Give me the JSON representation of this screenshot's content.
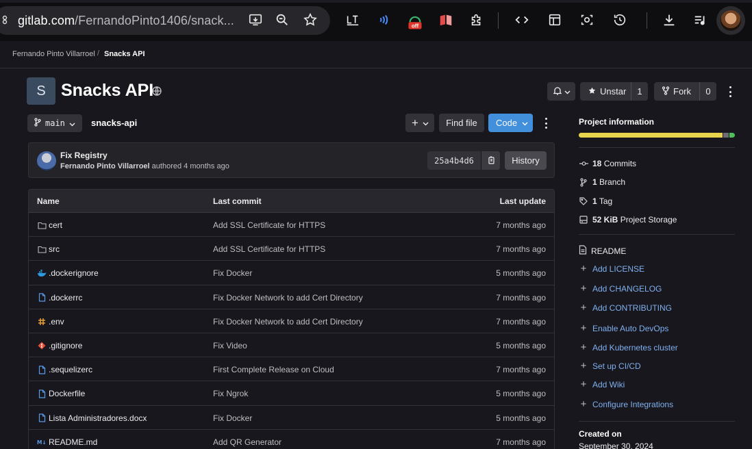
{
  "browser": {
    "url_host": "gitlab.com",
    "url_path": "/FernandoPinto1406/snack...",
    "extension_badge": "off"
  },
  "breadcrumb": {
    "owner": "Fernando Pinto Villarroel",
    "separator": "/",
    "project": "Snacks API"
  },
  "project": {
    "avatar_letter": "S",
    "title": "Snacks API",
    "unstar_label": "Unstar",
    "star_count": "1",
    "fork_label": "Fork",
    "fork_count": "0"
  },
  "branch": {
    "name": "main",
    "path": "snacks-api"
  },
  "actions": {
    "add_label": "+",
    "find_file_label": "Find file",
    "code_label": "Code"
  },
  "last_commit": {
    "title": "Fix Registry",
    "author": "Fernando Pinto Villarroel",
    "meta": "authored 4 months ago",
    "sha": "25a4b4d6",
    "history_label": "History"
  },
  "table": {
    "headers": [
      "Name",
      "Last commit",
      "Last update"
    ],
    "rows": [
      {
        "name": "cert",
        "icon": "folder-icon",
        "commit": "Add SSL Certificate for HTTPS",
        "updated": "7 months ago"
      },
      {
        "name": "src",
        "icon": "folder-icon",
        "commit": "Add SSL Certificate for HTTPS",
        "updated": "7 months ago"
      },
      {
        "name": ".dockerignore",
        "icon": "docker-icon",
        "commit": "Fix Docker",
        "updated": "5 months ago"
      },
      {
        "name": ".dockerrc",
        "icon": "file-icon",
        "commit": "Fix Docker Network to add Cert Directory",
        "updated": "7 months ago"
      },
      {
        "name": ".env",
        "icon": "env-icon",
        "commit": "Fix Docker Network to add Cert Directory",
        "updated": "7 months ago"
      },
      {
        "name": ".gitignore",
        "icon": "git-icon",
        "commit": "Fix Video",
        "updated": "5 months ago"
      },
      {
        "name": ".sequelizerc",
        "icon": "file-icon",
        "commit": "First Complete Release on Cloud",
        "updated": "7 months ago"
      },
      {
        "name": "Dockerfile",
        "icon": "file-icon",
        "commit": "Fix Ngrok",
        "updated": "5 months ago"
      },
      {
        "name": "Lista Administradores.docx",
        "icon": "file-icon",
        "commit": "Fix Docker",
        "updated": "5 months ago"
      },
      {
        "name": "README.md",
        "icon": "markdown-icon",
        "commit": "Add QR Generator",
        "updated": "7 months ago"
      }
    ]
  },
  "sidebar": {
    "title": "Project information",
    "languages": [
      {
        "color": "#e8d44d",
        "fraction": 0.93
      },
      {
        "color": "#6c6c72",
        "fraction": 0.035
      },
      {
        "color": "#4fbf5a",
        "fraction": 0.035
      }
    ],
    "stats": [
      {
        "count": "18",
        "label": "Commits",
        "icon": "commit-icon"
      },
      {
        "count": "1",
        "label": "Branch",
        "icon": "branch-icon"
      },
      {
        "count": "1",
        "label": "Tag",
        "icon": "tag-icon"
      },
      {
        "count": "52 KiB",
        "label": "Project Storage",
        "icon": "storage-icon"
      }
    ],
    "readme_label": "README",
    "links": [
      "Add LICENSE",
      "Add CHANGELOG",
      "Add CONTRIBUTING",
      "Enable Auto DevOps",
      "Add Kubernetes cluster",
      "Set up CI/CD",
      "Add Wiki",
      "Configure Integrations"
    ],
    "created_label": "Created on",
    "created_date": "September 30, 2024"
  }
}
